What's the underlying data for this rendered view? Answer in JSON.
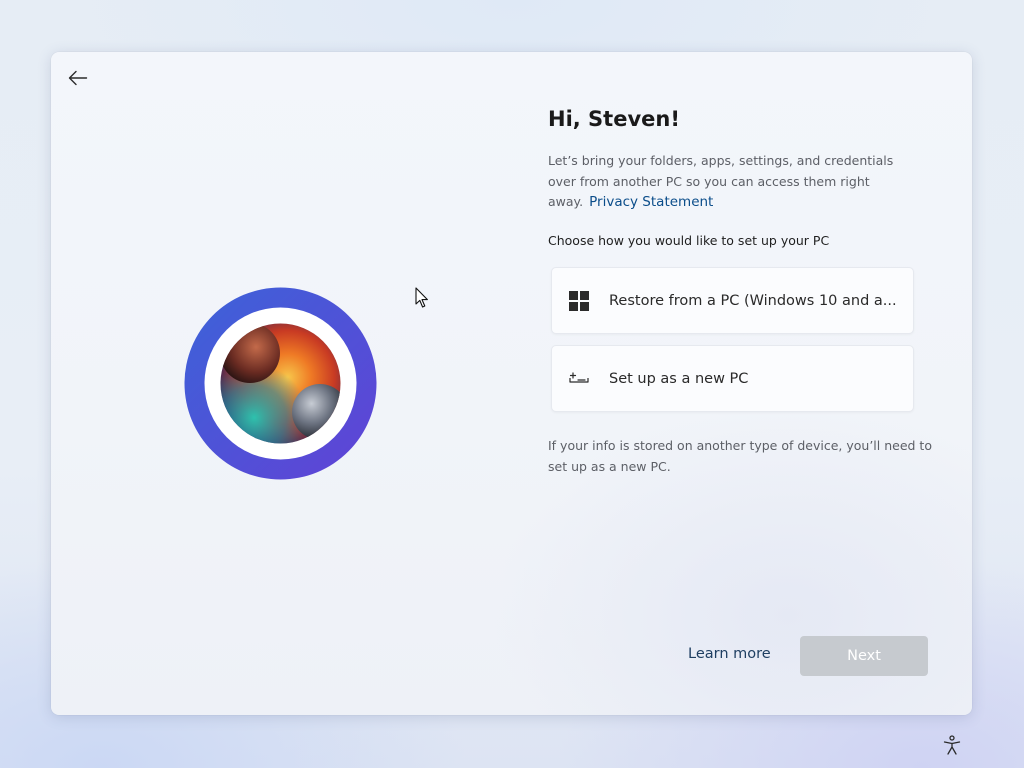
{
  "header": {
    "back_icon": "back-arrow-icon"
  },
  "emblem": {
    "ring_color_start": "#3c5fd6",
    "ring_color_end": "#6342d8",
    "image_description_icon": "nebula-planets-image"
  },
  "main": {
    "greeting": "Hi, Steven!",
    "intro_text": "Let’s bring your folders, apps, settings, and credentials over from another PC so you can access them right away.",
    "privacy_link": "Privacy Statement",
    "choose_label": "Choose how you would like to set up your PC",
    "options": [
      {
        "label": "Restore from a PC (Windows 10 and a...",
        "icon": "windows-logo-icon"
      },
      {
        "label": "Set up as a new PC",
        "icon": "new-pc-icon"
      }
    ],
    "footnote": "If your info is stored on another type of device, you’ll need to set up as a new PC."
  },
  "footer": {
    "learn_more": "Learn more",
    "next_label": "Next",
    "next_enabled": false
  },
  "system": {
    "accessibility_icon": "accessibility-icon"
  },
  "colors": {
    "link": "#0b4d8a",
    "next_disabled_bg": "#c6cacf",
    "window_bg": "#f2f5fa"
  }
}
